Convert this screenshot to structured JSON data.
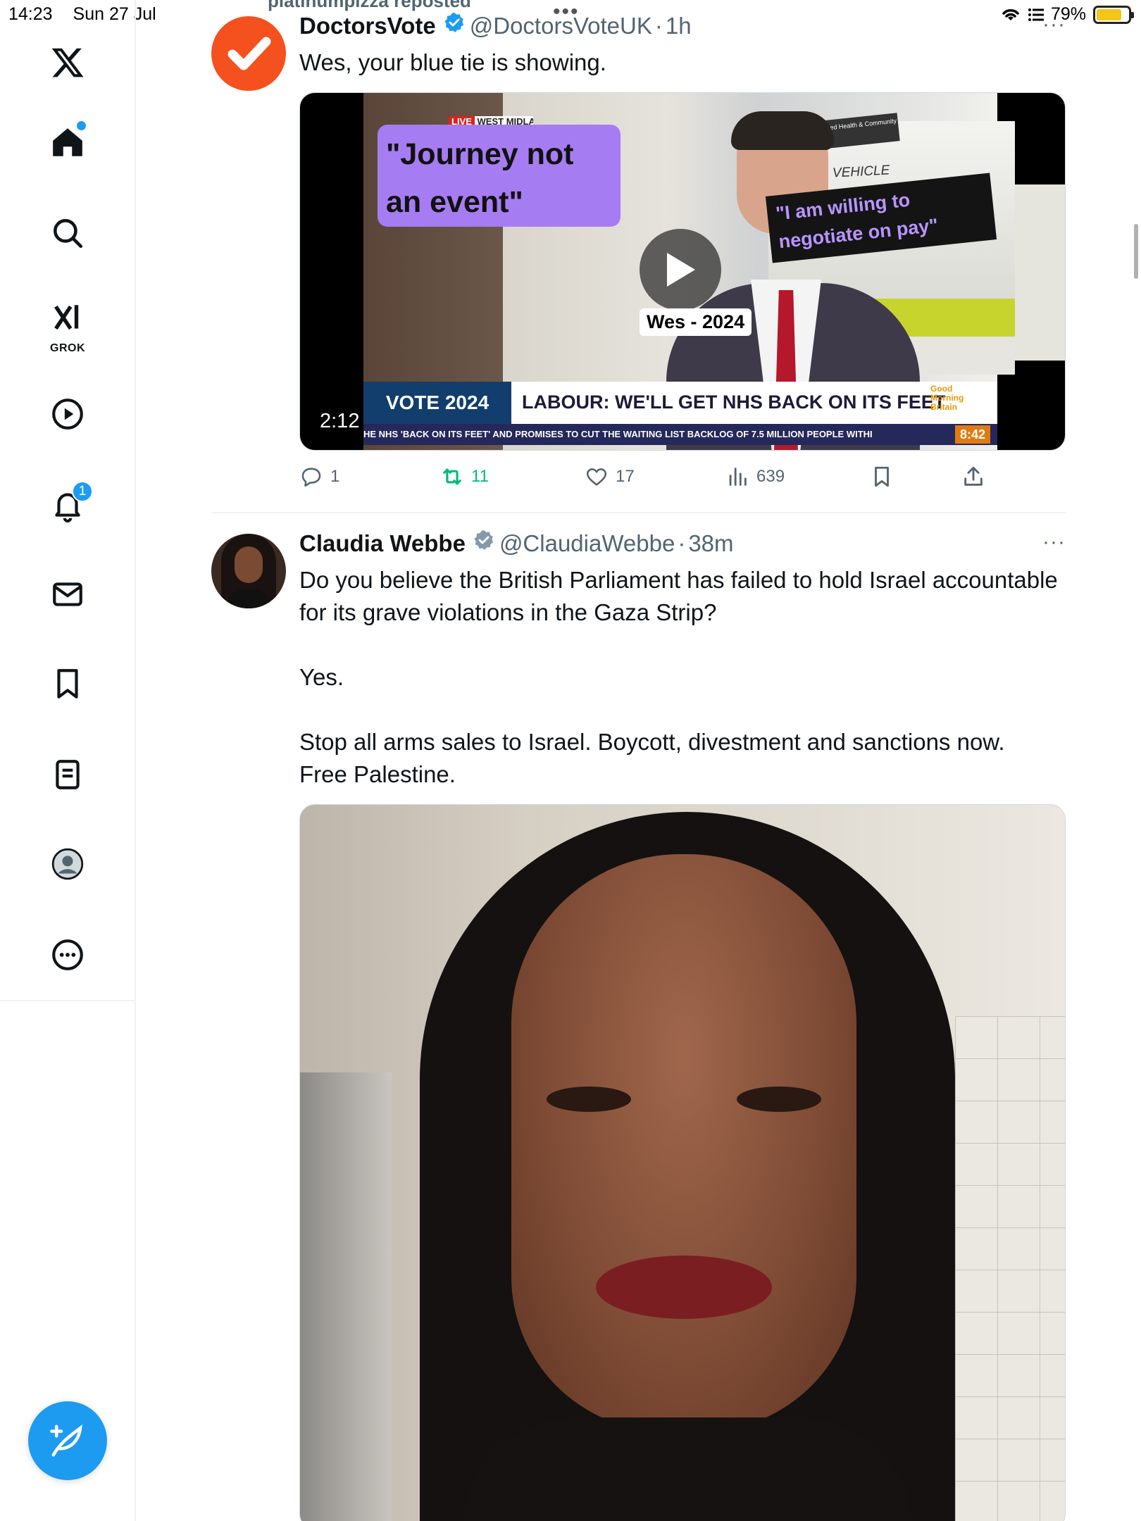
{
  "status_bar": {
    "time": "14:23",
    "date": "Sun 27 Jul",
    "battery": "79%",
    "battery_level": 0.79,
    "icons": [
      "wifi-icon",
      "focus-list-icon",
      "battery-charging-icon"
    ]
  },
  "sidebar": {
    "items": [
      {
        "name": "x-logo",
        "icon": "x-logo-icon"
      },
      {
        "name": "home",
        "icon": "home-icon"
      },
      {
        "name": "explore",
        "icon": "search-icon"
      },
      {
        "name": "grok",
        "icon": "grok-icon",
        "label": "GROK"
      },
      {
        "name": "videos",
        "icon": "play-icon"
      },
      {
        "name": "notifications",
        "icon": "bell-icon",
        "badge": "1"
      },
      {
        "name": "messages",
        "icon": "mail-icon"
      },
      {
        "name": "bookmarks",
        "icon": "bookmark-icon"
      },
      {
        "name": "lists",
        "icon": "list-icon"
      },
      {
        "name": "profile",
        "icon": "profile-icon"
      },
      {
        "name": "more",
        "icon": "more-circle-icon"
      }
    ],
    "compose_icon": "compose-icon"
  },
  "feed": {
    "repost_banner": "platinumpizza reposted",
    "tweets": [
      {
        "name": "DoctorsVote",
        "handle": "@DoctorsVoteUK",
        "time": "1h",
        "text": "Wes, your blue tie is showing.",
        "media": {
          "type": "video",
          "duration": "2:12",
          "overlay_1": "\"Journey not an event\"",
          "overlay_2": "\"I am willing to negotiate on pay\"",
          "caption": "Wes - 2024",
          "vehicle_text": "TRAINING VEHICLE",
          "vehicle_sign": "School of Allied Health & Community",
          "live_tag": "LIVE",
          "location": "WEST MIDLANDS",
          "ticker_left": "VOTE 2024",
          "ticker_headline": "LABOUR: WE'LL GET NHS BACK ON ITS FEET",
          "ticker_brand": "Good Morning Britain",
          "ticker_crawl": "HE NHS 'BACK ON ITS FEET' AND PROMISES TO CUT THE WAITING LIST BACKLOG OF 7.5 MILLION PEOPLE WITHI",
          "ticker_clock": "8:42"
        },
        "actions": {
          "replies": "1",
          "reposts": "11",
          "likes": "17",
          "views": "639"
        }
      },
      {
        "name": "Claudia Webbe",
        "handle": "@ClaudiaWebbe",
        "time": "38m",
        "text_lines": [
          "Do you believe the British Parliament has failed to hold Israel accountable for its grave violations in the Gaza Strip?",
          "",
          "Yes.",
          "",
          "Stop all arms sales to Israel. Boycott, divestment and sanctions now.",
          "Free Palestine."
        ],
        "media": {
          "type": "video"
        }
      }
    ]
  },
  "colors": {
    "accent": "#1d9bf0",
    "repost_green": "#00ba7c",
    "doctorsvote_orange": "#f4511e",
    "overlay_purple": "#a67cf2"
  }
}
